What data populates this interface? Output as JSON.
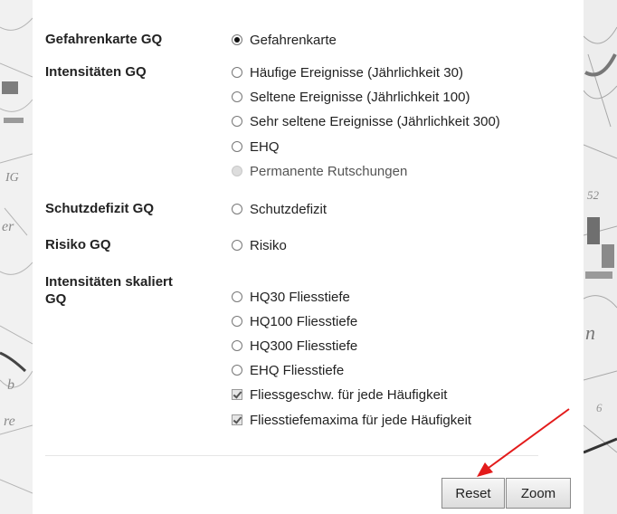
{
  "categories": {
    "gefahrenkarte": "Gefahrenkarte GQ",
    "intensitaeten": "Intensitäten GQ",
    "schutzdefizit": "Schutzdefizit GQ",
    "risiko": "Risiko GQ",
    "skaliert_line1": "Intensitäten skaliert",
    "skaliert_line2": "GQ"
  },
  "options": {
    "gefahrenkarte": "Gefahrenkarte",
    "haeufige": "Häufige Ereignisse (Jährlichkeit 30)",
    "seltene": "Seltene Ereignisse (Jährlichkeit 100)",
    "sehr_seltene": "Sehr seltene Ereignisse (Jährlichkeit 300)",
    "ehq": "EHQ",
    "rutschungen": "Permanente Rutschungen",
    "schutzdefizit": "Schutzdefizit",
    "risiko": "Risiko",
    "hq30": "HQ30 Fliesstiefe",
    "hq100": "HQ100 Fliesstiefe",
    "hq300": "HQ300 Fliesstiefe",
    "ehq_fliesstiefe": "EHQ Fliesstiefe",
    "fliessgeschw": "Fliessgeschw. für jede Häufigkeit",
    "fliesstiefemaxima": "Fliesstiefemaxima für jede Häufigkeit"
  },
  "buttons": {
    "reset": "Reset",
    "zoom": "Zoom"
  },
  "colors": {
    "annotation_arrow": "#e31b1b"
  }
}
